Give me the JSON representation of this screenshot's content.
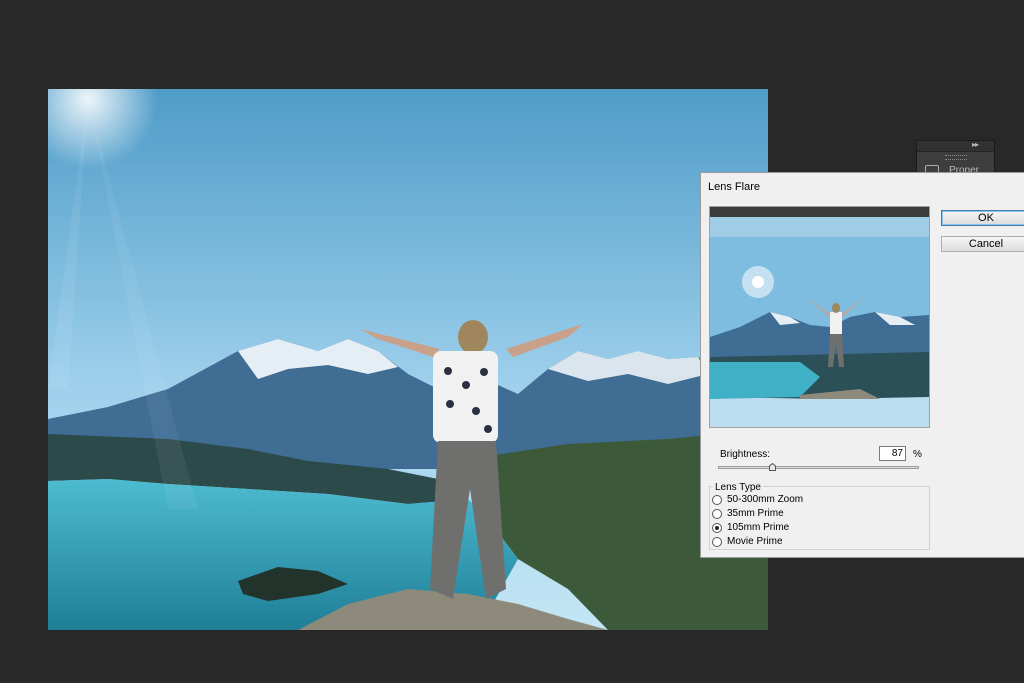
{
  "dialog": {
    "title": "Lens Flare",
    "ok_label": "OK",
    "cancel_label": "Cancel",
    "brightness_label": "Brightness:",
    "brightness_value": "87",
    "brightness_unit": "%",
    "brightness_slider_fraction": 0.27,
    "lens_type_label": "Lens Type",
    "lens_types": [
      {
        "label": "50-300mm Zoom",
        "checked": false
      },
      {
        "label": "35mm Prime",
        "checked": false
      },
      {
        "label": "105mm Prime",
        "checked": true
      },
      {
        "label": "Movie Prime",
        "checked": false
      }
    ]
  },
  "panel_dock": {
    "label": "Proper",
    "icon": "properties-icon"
  },
  "colors": {
    "workspace_bg": "#282828",
    "dialog_bg": "#f0f0f0",
    "ok_border": "#3c7fb1",
    "sky": "#7fbde0",
    "lake": "#2f8ea5"
  }
}
